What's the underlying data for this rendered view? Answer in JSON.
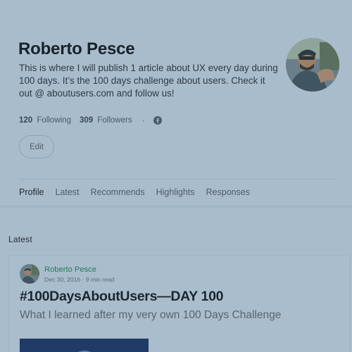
{
  "profile": {
    "name": "Roberto Pesce",
    "bio": "This is where I will publish 1 article about UX every day during 100 days. It’s the 100 days challenge about users. Check it out @ aboutusers.com and follow us!",
    "following_count": "120",
    "following_label": "Following",
    "followers_count": "309",
    "followers_label": "Followers",
    "separator": "·",
    "edit_label": "Edit"
  },
  "tabs": [
    {
      "label": "Profile",
      "active": true
    },
    {
      "label": "Latest"
    },
    {
      "label": "Recommends"
    },
    {
      "label": "Highlights"
    },
    {
      "label": "Responses"
    }
  ],
  "section": {
    "label": "Latest"
  },
  "post": {
    "author": "Roberto Pesce",
    "date": "Dec 30, 2016",
    "meta_separator": "·",
    "read_time": "9 min read",
    "title": "#100DaysAboutUsers—DAY 100",
    "subtitle": "What I learned after my very own 100 Days Challenge"
  },
  "icons": {
    "social": "facebook-icon"
  },
  "colors": {
    "background": "#a9bccb",
    "author_link": "#287b5c",
    "image_bg": "#1f3b66"
  }
}
